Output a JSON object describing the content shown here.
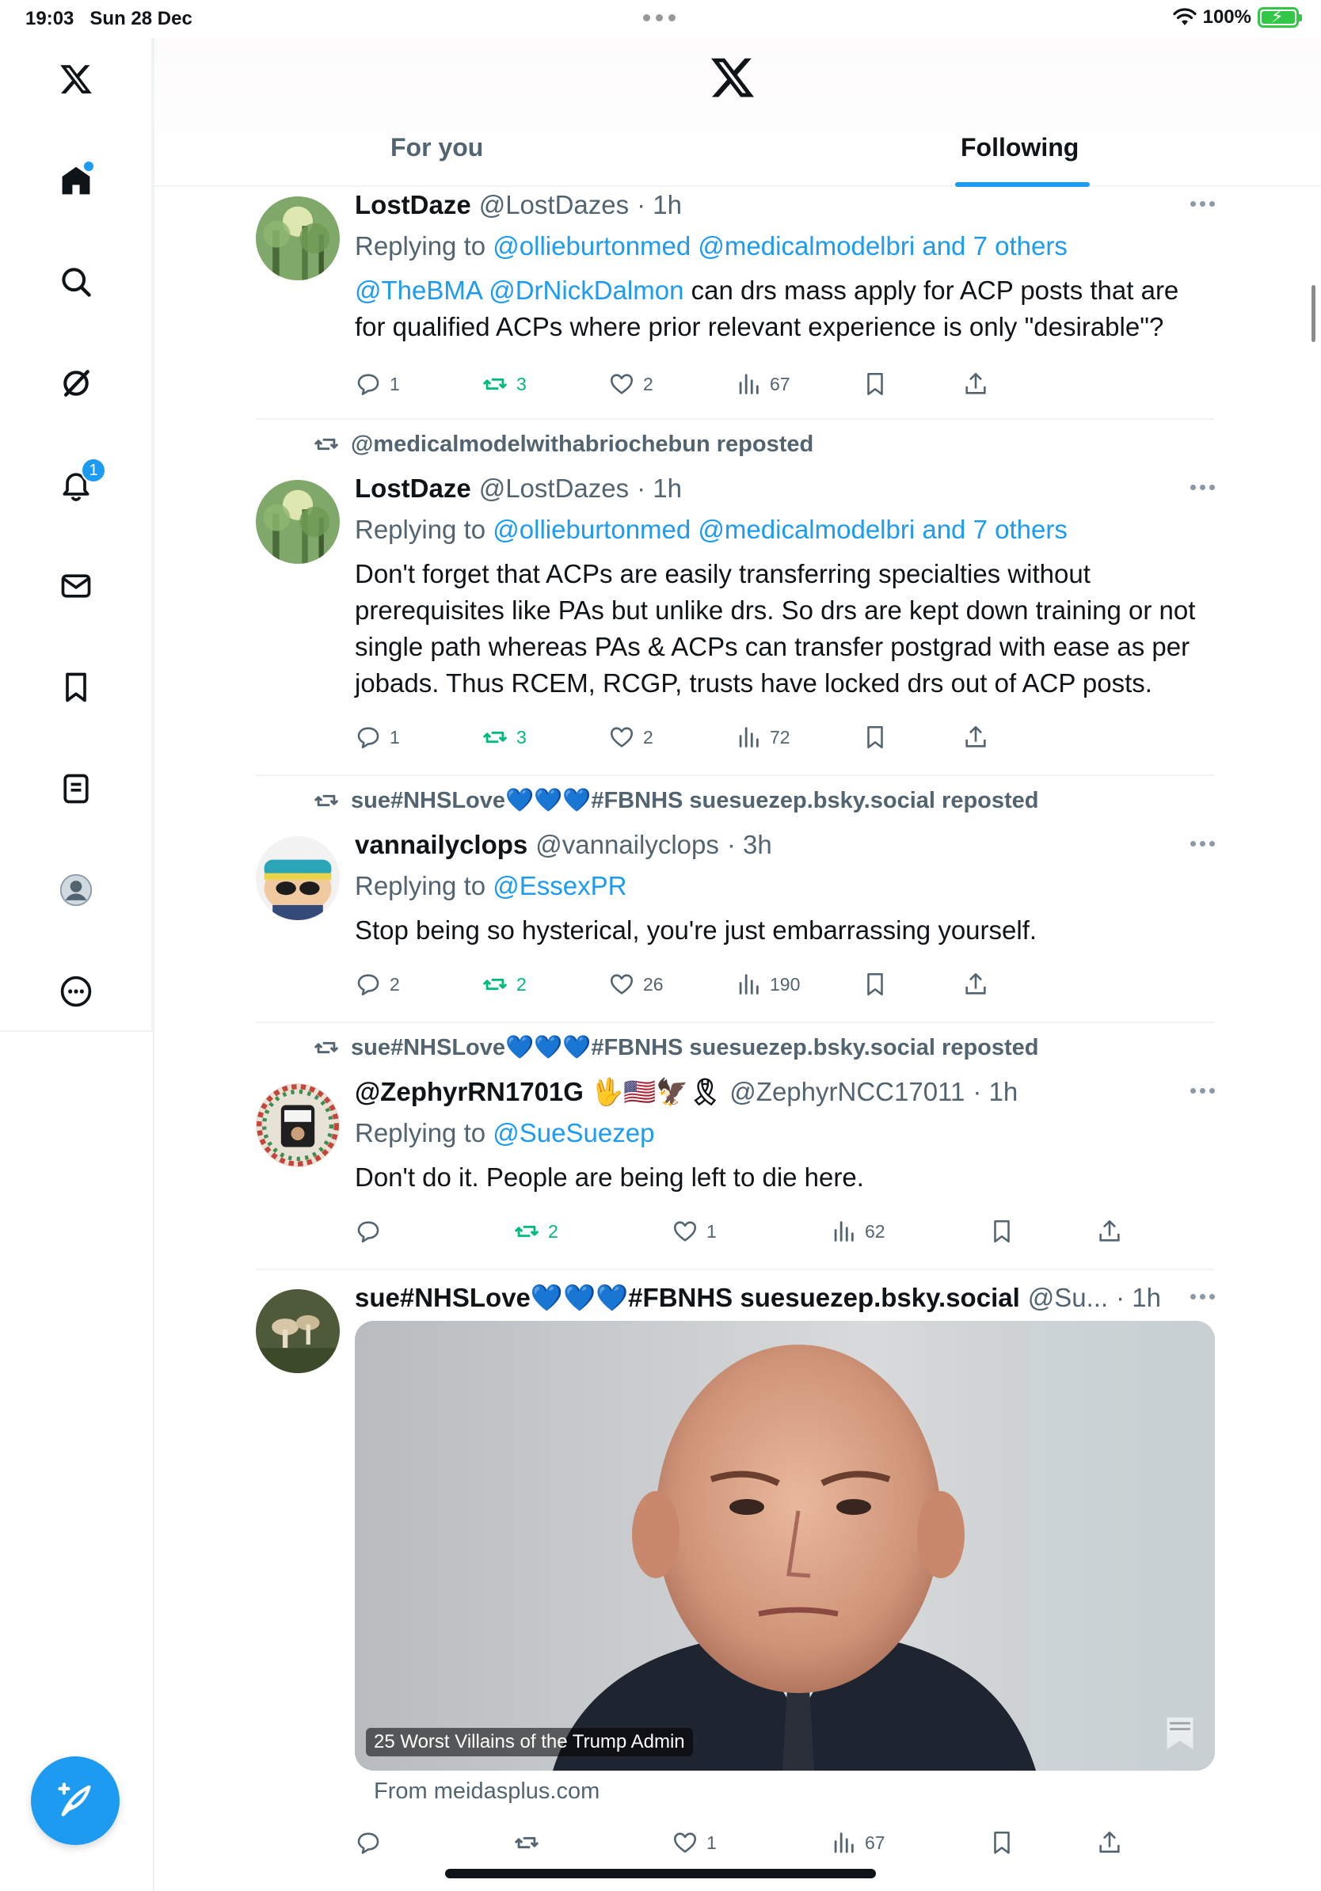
{
  "status_bar": {
    "time": "19:03",
    "date": "Sun 28 Dec",
    "battery": "100%"
  },
  "sidebar": {
    "items": [
      "x-logo",
      "home",
      "search",
      "grok",
      "notifications",
      "messages",
      "bookmarks",
      "lists",
      "profile",
      "more"
    ],
    "notifications_badge": "1"
  },
  "header": {
    "tabs": [
      "For you",
      "Following"
    ],
    "active_tab": "Following"
  },
  "tweets": [
    {
      "repost_by": "",
      "name": "LostDaze",
      "handle": "@LostDazes",
      "time": "· 1h",
      "replying_prefix": "Replying to",
      "replying_to": "@ollieburtonmed @medicalmodelbri and 7 others",
      "mentions": "@TheBMA @DrNickDalmon",
      "text": "can drs mass apply for ACP posts that are for qualified ACPs where prior relevant experience is only \"desirable\"?",
      "replies": "1",
      "reposts": "3",
      "likes": "2",
      "views": "67"
    },
    {
      "repost_by": "@medicalmodelwithabriochebun reposted",
      "name": "LostDaze",
      "handle": "@LostDazes",
      "time": "· 1h",
      "replying_prefix": "Replying to",
      "replying_to": "@ollieburtonmed @medicalmodelbri and 7 others",
      "text": "Don't forget that ACPs are easily transferring specialties without prerequisites like PAs but unlike drs. So drs are kept down training or not single path whereas PAs & ACPs can transfer postgrad with ease as per jobads. Thus RCEM, RCGP, trusts have locked drs out of ACP posts.",
      "replies": "1",
      "reposts": "3",
      "likes": "2",
      "views": "72"
    },
    {
      "repost_by": "sue#NHSLove💙💙💙#FBNHS suesuezep.bsky.social reposted",
      "name": "vannailyclops",
      "handle": "@vannailyclops",
      "time": "· 3h",
      "replying_prefix": "Replying to",
      "replying_to": "@EssexPR",
      "text": "Stop being so hysterical, you're just embarrassing yourself.",
      "replies": "2",
      "reposts": "2",
      "likes": "26",
      "views": "190"
    },
    {
      "repost_by": "sue#NHSLove💙💙💙#FBNHS suesuezep.bsky.social reposted",
      "name": "@ZephyrRN1701G 🖖🇺🇸🦅🎗",
      "handle": "@ZephyrNCC17011",
      "time": "· 1h",
      "replying_prefix": "Replying to",
      "replying_to": "@SueSuezep",
      "text": "Don't do it. People are being left to die here.",
      "replies": "",
      "reposts": "2",
      "likes": "1",
      "views": "62"
    },
    {
      "repost_by": "",
      "name": "sue#NHSLove💙💙💙#FBNHS suesuezep.bsky.social",
      "handle": "@Su...",
      "time": "· 1h",
      "media_caption": "25 Worst Villains of the Trump Admin",
      "media_source": "From meidasplus.com",
      "replies": "",
      "reposts": "",
      "likes": "1",
      "views": "67"
    }
  ],
  "colors": {
    "accent": "#1d9bf0",
    "repost_green": "#00ba7c",
    "muted": "#536471"
  }
}
